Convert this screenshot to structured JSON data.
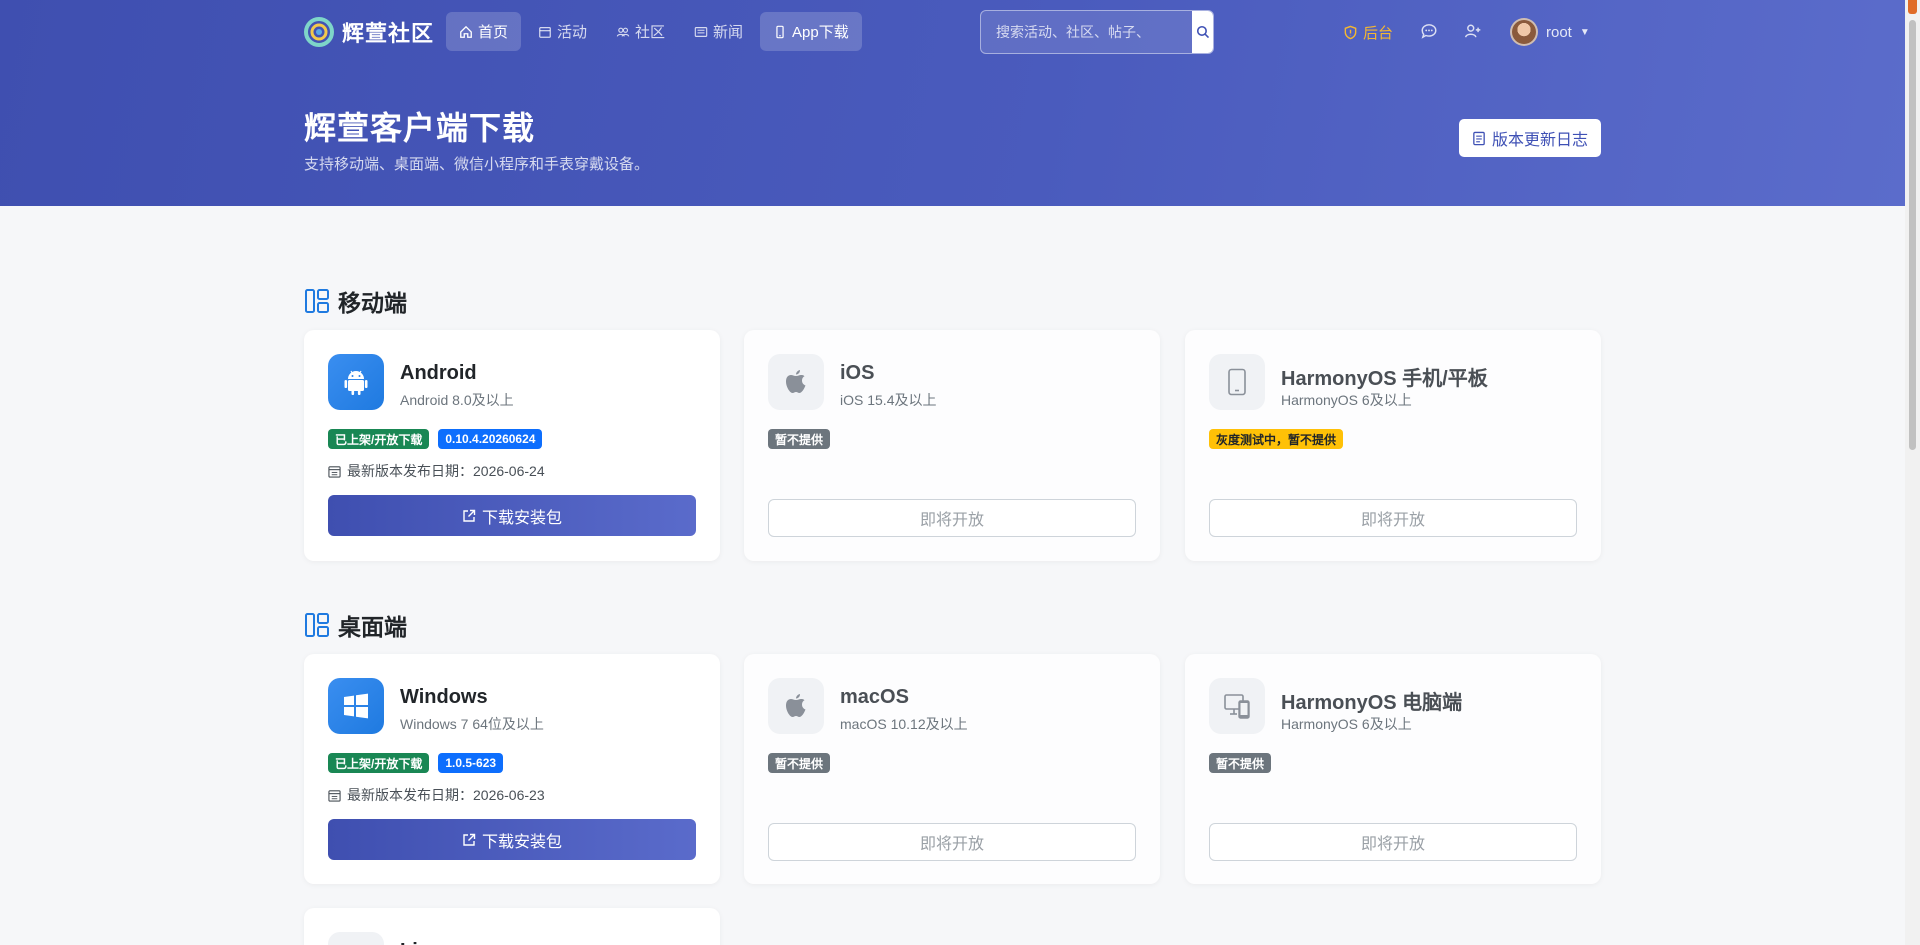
{
  "nav": {
    "brand": "辉萱社区",
    "items": [
      {
        "label": "首页",
        "icon": "home-icon"
      },
      {
        "label": "活动",
        "icon": "calendar-icon"
      },
      {
        "label": "社区",
        "icon": "people-icon"
      },
      {
        "label": "新闻",
        "icon": "newspaper-icon"
      },
      {
        "label": "App下载",
        "icon": "phone-icon"
      }
    ],
    "search_placeholder": "搜索活动、社区、帖子、",
    "admin_label": "后台",
    "username": "root"
  },
  "hero": {
    "title": "辉萱客户端下载",
    "subtitle": "支持移动端、桌面端、微信小程序和手表穿戴设备。",
    "changelog_label": "版本更新日志"
  },
  "sections": [
    {
      "title": "移动端",
      "cards": [
        {
          "name": "Android",
          "req": "Android 8.0及以上",
          "badges": [
            "已上架/开放下载",
            "0.10.4.20260624"
          ],
          "release": "最新版本发布日期：2026-06-24",
          "button": "下载安装包"
        },
        {
          "name": "iOS",
          "req": "iOS 15.4及以上",
          "badges": [
            "暂不提供"
          ],
          "button": "即将开放"
        },
        {
          "name": "HarmonyOS 手机/平板",
          "req": "HarmonyOS 6及以上",
          "badges": [
            "灰度测试中，暂不提供"
          ],
          "button": "即将开放"
        }
      ]
    },
    {
      "title": "桌面端",
      "cards": [
        {
          "name": "Windows",
          "req": "Windows 7 64位及以上",
          "badges": [
            "已上架/开放下载",
            "1.0.5-623"
          ],
          "release": "最新版本发布日期：2026-06-23",
          "button": "下载安装包"
        },
        {
          "name": "macOS",
          "req": "macOS 10.12及以上",
          "badges": [
            "暂不提供"
          ],
          "button": "即将开放"
        },
        {
          "name": "HarmonyOS 电脑端",
          "req": "HarmonyOS 6及以上",
          "badges": [
            "暂不提供"
          ],
          "button": "即将开放"
        }
      ]
    },
    {
      "cards": [
        {
          "name": "Li"
        }
      ]
    }
  ],
  "colors": {
    "primary": "#3f51b5",
    "success": "#198754",
    "info": "#0d6efd",
    "secondary": "#6c757d",
    "warning": "#ffc107",
    "admin": "#f5b731"
  }
}
